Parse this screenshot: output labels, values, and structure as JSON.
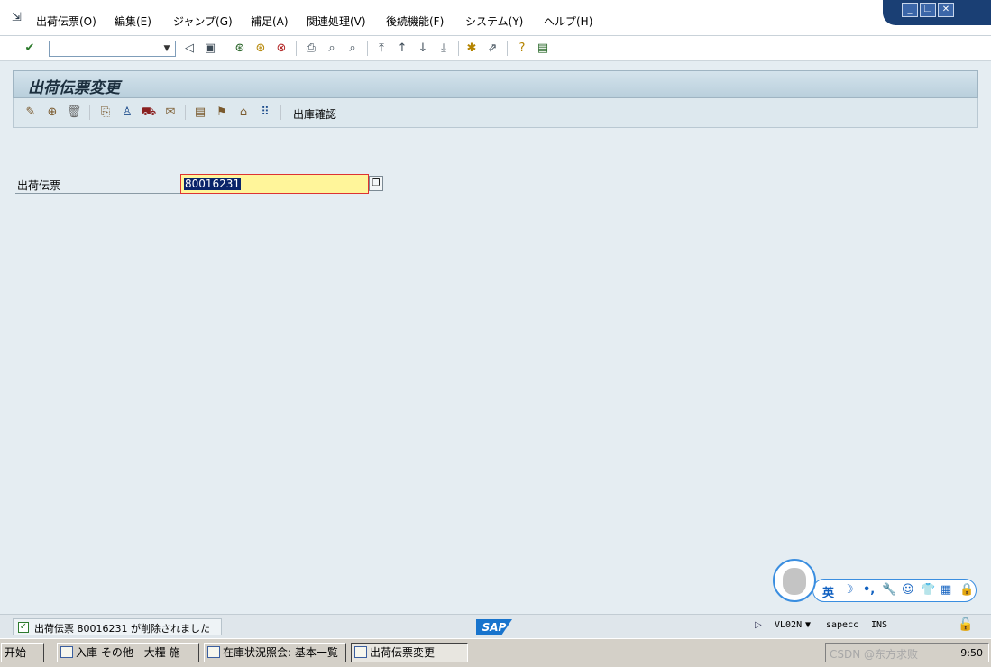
{
  "menu": {
    "items": [
      "出荷伝票(O)",
      "編集(E)",
      "ジャンプ(G)",
      "補足(A)",
      "関連処理(V)",
      "後続機能(F)",
      "システム(Y)",
      "ヘルプ(H)"
    ]
  },
  "window_controls": {
    "minimize": "_",
    "restore": "❐",
    "close": "✕"
  },
  "system_toolbar": {
    "command_field_value": ""
  },
  "title": "出荷伝票変更",
  "app_toolbar": {
    "text_button": "出庫確認"
  },
  "form": {
    "field_label": "出荷伝票",
    "field_value": "80016231"
  },
  "ime_bar": {
    "items": [
      "英",
      "☽",
      "•,",
      "🔧",
      "☺",
      "👕",
      "▦",
      "🔒"
    ]
  },
  "status_bar": {
    "message": "出荷伝票 80016231 が削除されました",
    "sap_logo": "SAP",
    "transaction": "VL02N",
    "server": "sapecc",
    "mode": "INS"
  },
  "taskbar": {
    "start_label": "开始",
    "tasks": [
      "入庫 その他 - 大糧 施",
      "在庫状況照会: 基本一覧",
      "出荷伝票変更"
    ],
    "watermark": "CSDN @东方求败",
    "clock": "9:50"
  }
}
